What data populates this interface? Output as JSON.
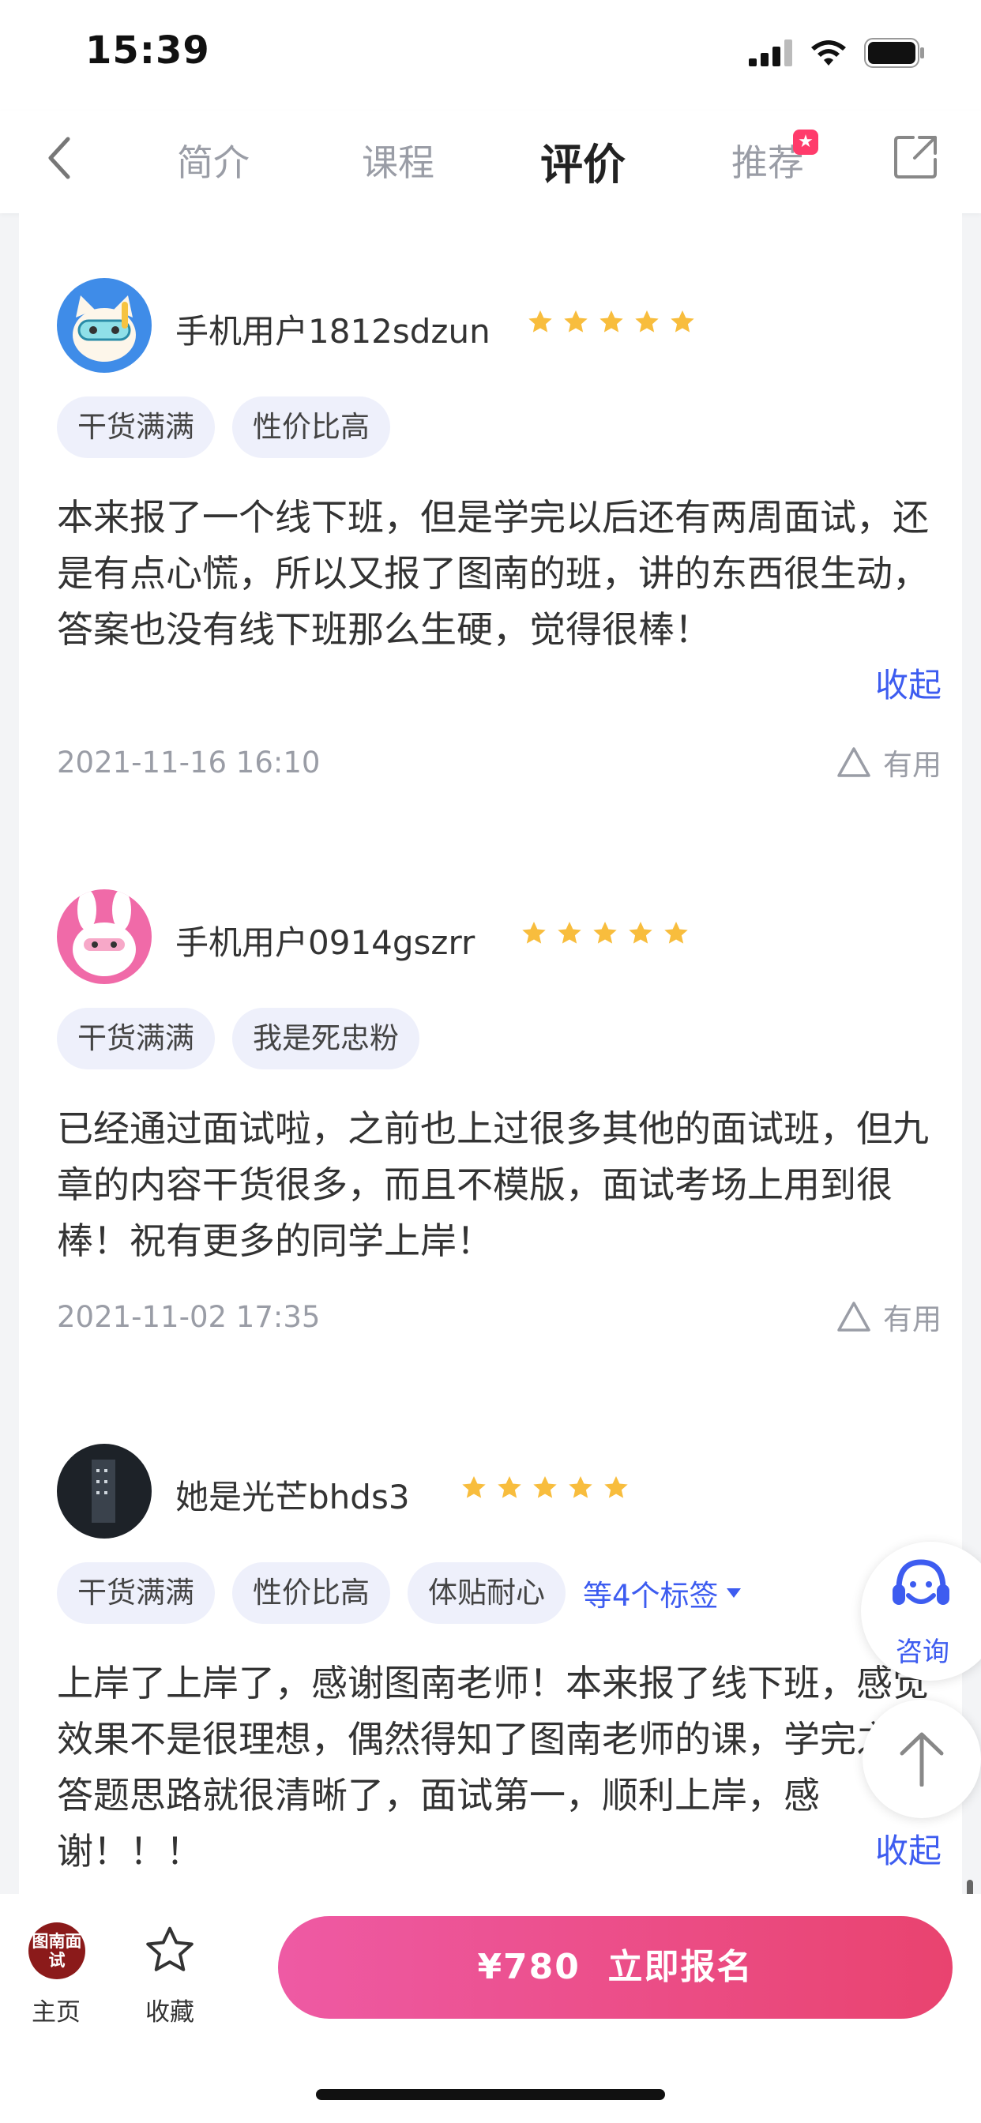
{
  "status_bar": {
    "time": "15:39"
  },
  "nav": {
    "tabs": [
      {
        "label": "简介"
      },
      {
        "label": "课程"
      },
      {
        "label": "评价"
      },
      {
        "label": "推荐"
      }
    ]
  },
  "reviews": [
    {
      "username": "手机用户1812sdzun",
      "rating": 5,
      "tags": [
        "干货满满",
        "性价比高"
      ],
      "content": "本来报了一个线下班，但是学完以后还有两周面试，还是有点心慌，所以又报了图南的班，讲的东西很生动，答案也没有线下班那么生硬，觉得很棒！",
      "collapse_label": "收起",
      "date": "2021-11-16 16:10",
      "useful_label": "有用"
    },
    {
      "username": "手机用户0914gszrr",
      "rating": 5,
      "tags": [
        "干货满满",
        "我是死忠粉"
      ],
      "content": "已经通过面试啦，之前也上过很多其他的面试班，但九章的内容干货很多，而且不模版，面试考场上用到很棒！祝有更多的同学上岸！",
      "date": "2021-11-02 17:35",
      "useful_label": "有用"
    },
    {
      "username": "她是光芒bhds3",
      "rating": 5,
      "tags": [
        "干货满满",
        "性价比高",
        "体贴耐心"
      ],
      "more_tags_label": "等4个标签",
      "content": "上岸了上岸了，感谢图南老师！本来报了线下班，感觉效果不是很理想，偶然得知了图南老师的课，学完之后答题思路就很清晰了，面试第一，顺利上岸，感谢！！！",
      "collapse_label": "收起"
    }
  ],
  "floating": {
    "consult_label": "咨询"
  },
  "bottom_bar": {
    "home_logo": "图南面试",
    "home_label": "主页",
    "favorite_label": "收藏",
    "enroll_label": "¥780  立即报名"
  },
  "colors": {
    "accent": "#3d5cf0",
    "star": "#f8bd3d",
    "enroll_gradient_start": "#ee5aa4",
    "enroll_gradient_end": "#e9436f"
  }
}
